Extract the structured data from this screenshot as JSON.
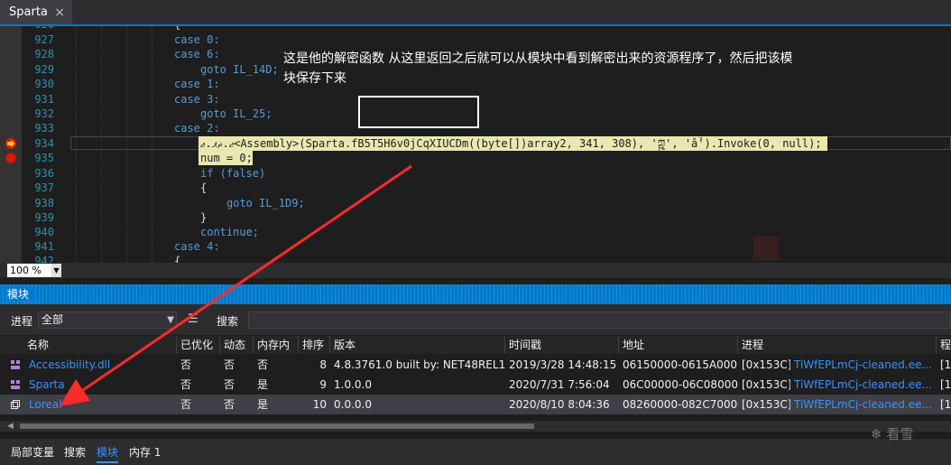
{
  "tab": {
    "title": "Sparta",
    "close": "×"
  },
  "editor": {
    "lines": [
      {
        "n": "926",
        "code": "{"
      },
      {
        "n": "927",
        "code": "case 0:"
      },
      {
        "n": "928",
        "code": "case 6:"
      },
      {
        "n": "929",
        "code": "goto IL_14D;"
      },
      {
        "n": "930",
        "code": "case 1:"
      },
      {
        "n": "931",
        "code": "case 3:"
      },
      {
        "n": "932",
        "code": "goto IL_25;"
      },
      {
        "n": "933",
        "code": "case 2:"
      },
      {
        "n": "934",
        "code": "ޖ.ޘޕ.ޖ<Assembly>(Sparta.fB5T5H6v0jCqXIUCDm((byte[])array2, 341, 308), 'ཀྵ', 'ẩ').Invoke(0, null);"
      },
      {
        "n": "935",
        "code": "num = 0;"
      },
      {
        "n": "936",
        "code": "if (false)"
      },
      {
        "n": "937",
        "code": "{"
      },
      {
        "n": "938",
        "code": "goto IL_1D9;"
      },
      {
        "n": "939",
        "code": "}"
      },
      {
        "n": "940",
        "code": "continue;"
      },
      {
        "n": "941",
        "code": "case 4:"
      },
      {
        "n": "942",
        "code": "{"
      }
    ],
    "annotation_line1": "这是他的解密函数 从这里返回之后就可以从模块中看到解密出来的资源程序了，然后把该模",
    "annotation_line2": "块保存下来"
  },
  "zoom": {
    "value": "100 %"
  },
  "modules": {
    "title": "模块",
    "process_label": "进程",
    "process_value": "全部",
    "search_label": "搜索",
    "columns": [
      "名称",
      "已优化",
      "动态",
      "内存内",
      "排序",
      "版本",
      "时间戳",
      "地址",
      "进程",
      "程"
    ],
    "rows": [
      {
        "name": "Accessibility.dll",
        "optimized": "否",
        "dynamic": "否",
        "inmem": "否",
        "order": "8",
        "version": "4.8.3761.0 built by: NET48REL1",
        "timestamp": "2019/3/28 14:48:15",
        "address": "06150000-0615A000",
        "process_id": "[0x153C]",
        "process_name": "TiWfEPLmCj-cleaned.ee...",
        "tail": "[1"
      },
      {
        "name": "Sparta",
        "optimized": "否",
        "dynamic": "否",
        "inmem": "是",
        "order": "9",
        "version": "1.0.0.0",
        "timestamp": "2020/7/31 7:56:04",
        "address": "06C00000-06C08000",
        "process_id": "[0x153C]",
        "process_name": "TiWfEPLmCj-cleaned.ee...",
        "tail": "[1"
      },
      {
        "name": "Loreal",
        "optimized": "否",
        "dynamic": "否",
        "inmem": "是",
        "order": "10",
        "version": "0.0.0.0",
        "timestamp": "2020/8/10 8:04:36",
        "address": "08260000-082C7000",
        "process_id": "[0x153C]",
        "process_name": "TiWfEPLmCj-cleaned.ee...",
        "tail": "[1"
      }
    ]
  },
  "bottom_tabs": [
    "局部变量",
    "搜索",
    "模块",
    "内存 1"
  ],
  "watermark": "看雪",
  "colors": {
    "accent": "#007acc",
    "annotation_arrow": "#ff2a2a",
    "breakpoint": "#e51400",
    "highlight": "#e8e8b0"
  }
}
